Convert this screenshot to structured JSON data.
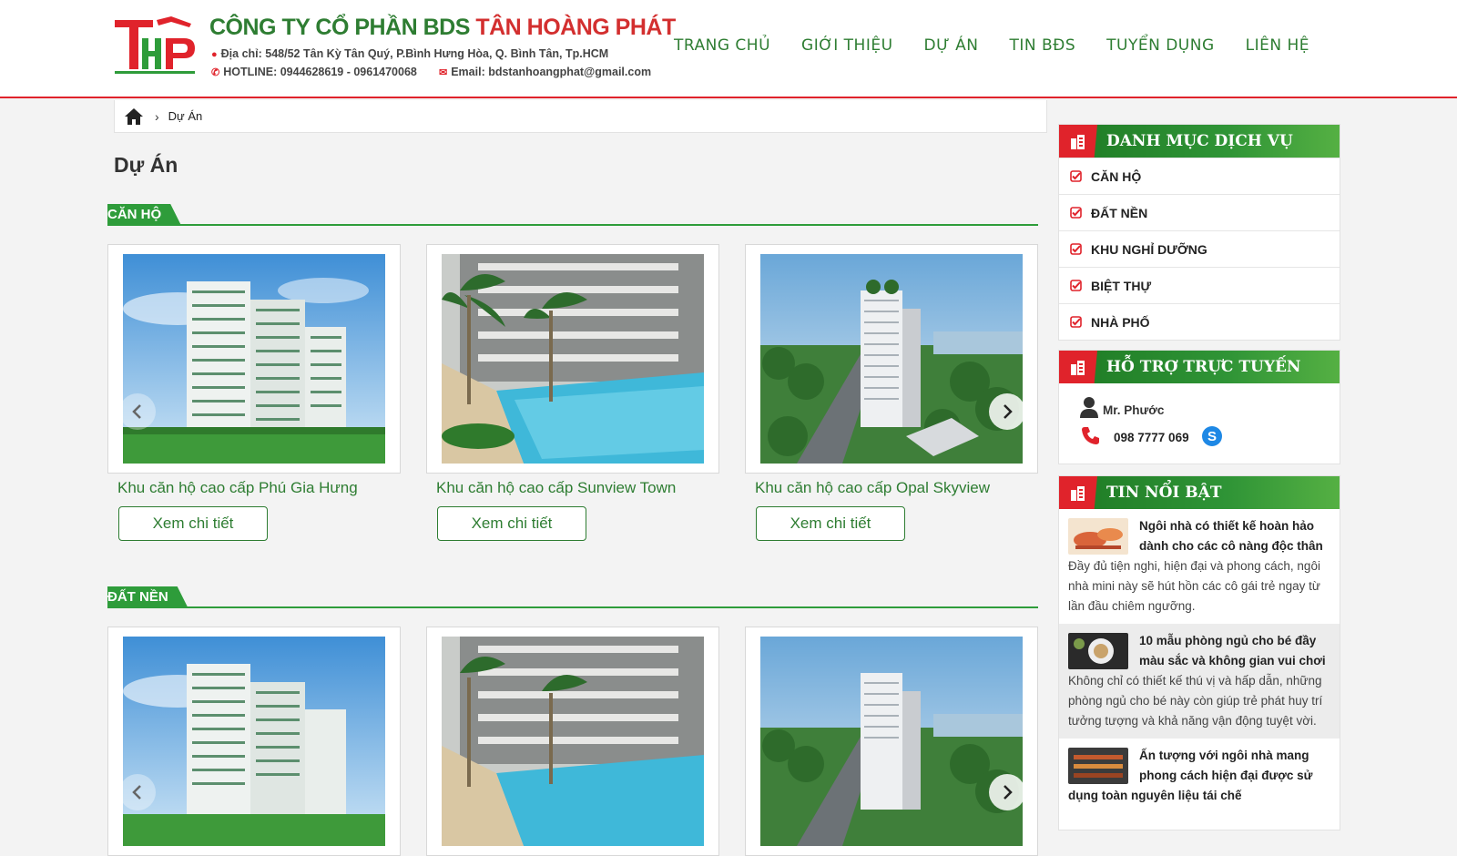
{
  "header": {
    "company_name_green": "CÔNG TY CỔ PHẦN BDS",
    "company_name_red": "TÂN HOÀNG PHÁT",
    "address": "Địa chỉ: 548/52 Tân Kỳ Tân Quý,  P.Bình Hưng Hòa,  Q. Bình Tân, Tp.HCM",
    "hotline": "HOTLINE: 0944628619 - 0961470068",
    "email": "Email: bdstanhoangphat@gmail.com"
  },
  "nav": [
    {
      "label": "TRANG CHỦ"
    },
    {
      "label": "GIỚI THIỆU"
    },
    {
      "label": "DỰ ÁN"
    },
    {
      "label": "TIN BĐS"
    },
    {
      "label": "TUYỂN DỤNG"
    },
    {
      "label": "LIÊN HỆ"
    }
  ],
  "breadcrumb": {
    "current": "Dự Án"
  },
  "page_title": "Dự Án",
  "sections": [
    {
      "tag": "CĂN HỘ",
      "cards": [
        {
          "title": "Khu căn hộ cao cấp Phú Gia Hưng",
          "button": "Xem chi tiết"
        },
        {
          "title": "Khu căn hộ cao cấp Sunview Town",
          "button": "Xem chi tiết"
        },
        {
          "title": "Khu căn hộ cao cấp Opal Skyview",
          "button": "Xem chi tiết"
        }
      ]
    },
    {
      "tag": "ĐẤT NỀN",
      "cards": [
        {
          "title": "",
          "button": ""
        },
        {
          "title": "",
          "button": ""
        },
        {
          "title": "",
          "button": ""
        }
      ]
    }
  ],
  "sidebar": {
    "categories": {
      "title": "DANH MỤC DỊCH VỤ",
      "items": [
        "CĂN HỘ",
        "ĐẤT NỀN",
        "KHU NGHỈ DƯỠNG",
        "BIỆT THỰ",
        "NHÀ PHỐ"
      ]
    },
    "support": {
      "title": "HỖ TRỢ TRỰC TUYẾN",
      "name": "Mr. Phước",
      "phone": "098 7777 069"
    },
    "news": {
      "title": "TIN NỔI BẬT",
      "items": [
        {
          "title": "Ngôi nhà có thiết kế hoàn hảo dành cho các cô nàng độc thân",
          "desc": "Đầy đủ tiện nghi, hiện đại và phong cách, ngôi nhà mini này sẽ hút hồn các cô gái trẻ ngay từ lần đầu chiêm ngưỡng."
        },
        {
          "title": "10 mẫu phòng ngủ cho bé đầy màu sắc và không gian vui chơi",
          "desc": "Không chỉ có thiết kế thú vị và hấp dẫn, những phòng ngủ cho bé này còn giúp trẻ phát huy trí tưởng tượng và khả năng vận động tuyệt vời."
        },
        {
          "title": "Ấn tượng với ngôi nhà mang phong cách hiện đại được sử dụng toàn nguyên liệu tái chế",
          "desc": ""
        }
      ]
    }
  },
  "colors": {
    "brand_green": "#2e7d32",
    "accent_red": "#e0232b",
    "section_green": "#2e9c3a"
  }
}
